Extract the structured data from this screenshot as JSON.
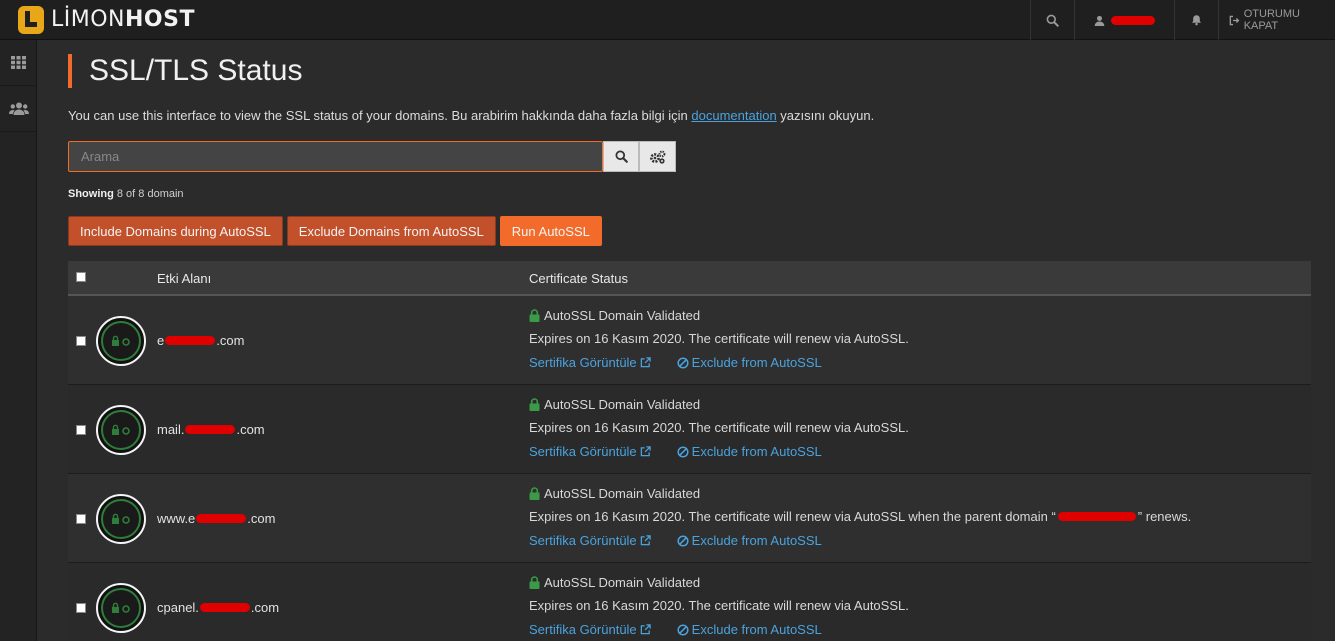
{
  "brand": {
    "name_light": "LİMON",
    "name_bold": "HOST"
  },
  "topbar": {
    "logout_label": "OTURUMU KAPAT"
  },
  "sidebar": {
    "items": [
      {
        "icon": "grid-icon"
      },
      {
        "icon": "users-icon"
      }
    ]
  },
  "page": {
    "title": "SSL/TLS Status",
    "desc_before": "You can use this interface to view the SSL status of your domains. Bu arabirim hakkında daha fazla bilgi için ",
    "desc_link": "documentation",
    "desc_after": " yazısını okuyun."
  },
  "search": {
    "placeholder": "Arama"
  },
  "showing": {
    "label": "Showing",
    "text": " 8 of 8 domain"
  },
  "actions": {
    "include": "Include Domains during AutoSSL",
    "exclude": "Exclude Domains from AutoSSL",
    "run": "Run AutoSSL"
  },
  "table": {
    "headers": {
      "domain": "Etki Alanı",
      "status": "Certificate Status"
    },
    "rows": [
      {
        "prefix": "e",
        "suffix": ".com",
        "status": "AutoSSL Domain Validated",
        "expires": "Expires on 16 Kasım 2020. The certificate will renew via AutoSSL.",
        "expires_tail": "",
        "view": "Sertifika Görüntüle",
        "exclude": "Exclude from AutoSSL"
      },
      {
        "prefix": "mail.",
        "suffix": ".com",
        "status": "AutoSSL Domain Validated",
        "expires": "Expires on 16 Kasım 2020. The certificate will renew via AutoSSL.",
        "expires_tail": "",
        "view": "Sertifika Görüntüle",
        "exclude": "Exclude from AutoSSL"
      },
      {
        "prefix": "www.e",
        "suffix": ".com",
        "status": "AutoSSL Domain Validated",
        "expires": "Expires on 16 Kasım 2020. The certificate will renew via AutoSSL when the parent domain “",
        "expires_tail": "” renews.",
        "view": "Sertifika Görüntüle",
        "exclude": "Exclude from AutoSSL"
      },
      {
        "prefix": "cpanel.",
        "suffix": ".com",
        "status": "AutoSSL Domain Validated",
        "expires": "Expires on 16 Kasım 2020. The certificate will renew via AutoSSL.",
        "expires_tail": "",
        "view": "Sertifika Görüntüle",
        "exclude": "Exclude from AutoSSL"
      }
    ]
  },
  "colors": {
    "accent": "#f26b2a",
    "link": "#4aa3df",
    "lock": "#3a9a48"
  }
}
